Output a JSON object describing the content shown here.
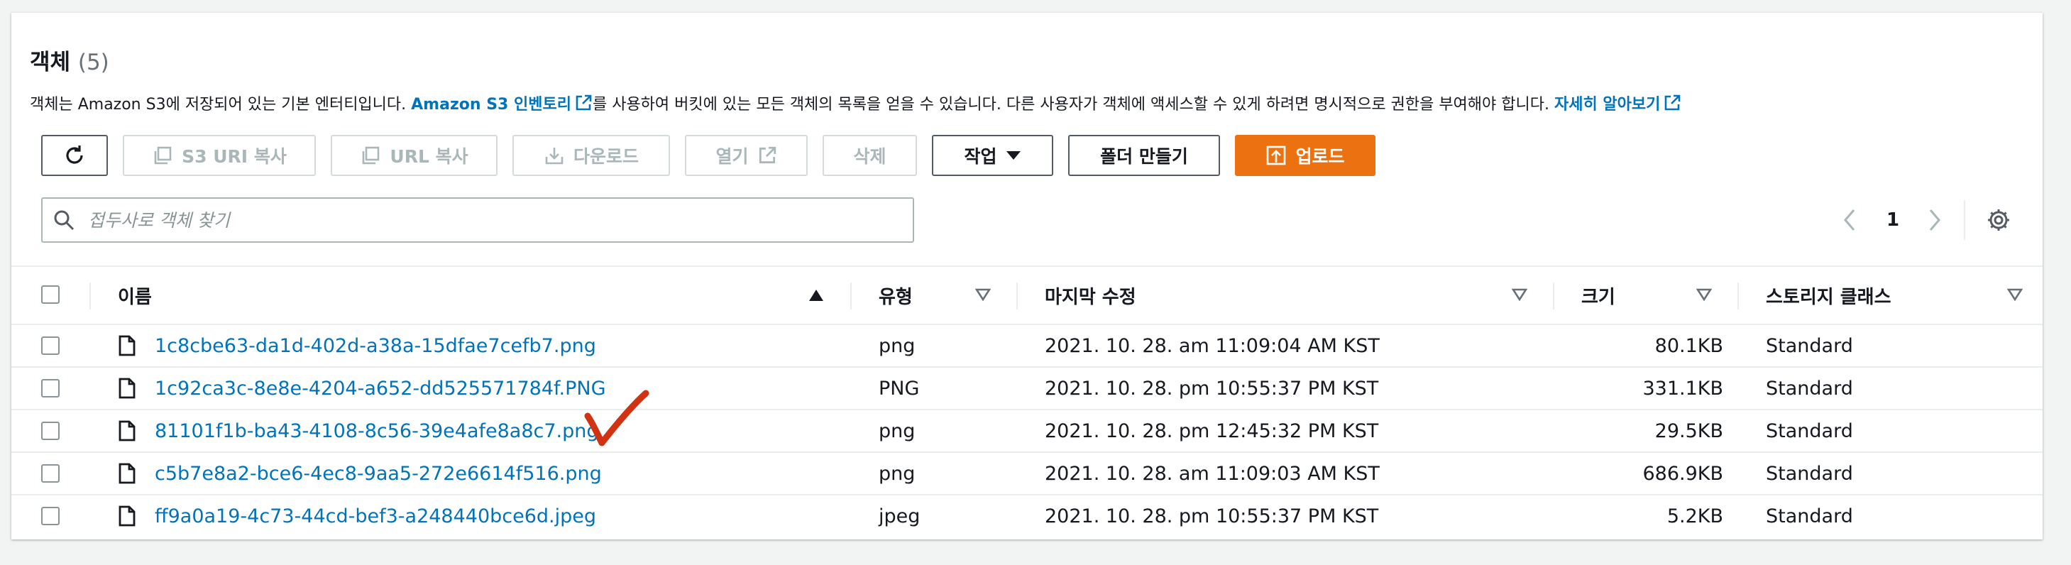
{
  "header": {
    "title": "객체",
    "count": "(5)",
    "desc_prefix": "객체는 Amazon S3에 저장되어 있는 기본 엔터티입니다. ",
    "inventory_link": "Amazon S3 인벤토리",
    "desc_middle": "를 사용하여 버킷에 있는 모든 객체의 목록을 얻을 수 있습니다. 다른 사용자가 객체에 액세스할 수 있게 하려면 명시적으로 권한을 부여해야 합니다. ",
    "learn_more_link": "자세히 알아보기"
  },
  "toolbar": {
    "refresh_icon": "refresh-icon",
    "copy_s3_uri": "S3 URI 복사",
    "copy_url": "URL 복사",
    "download": "다운로드",
    "open": "열기",
    "delete": "삭제",
    "actions": "작업",
    "create_folder": "폴더 만들기",
    "upload": "업로드"
  },
  "search": {
    "placeholder": "접두사로 객체 찾기"
  },
  "pagination": {
    "current_page": "1"
  },
  "colors": {
    "link": "#0073bb",
    "primary": "#ec7211",
    "checkmark": "#d13212"
  },
  "table": {
    "columns": {
      "name": "이름",
      "type": "유형",
      "last_modified": "마지막 수정",
      "size": "크기",
      "storage_class": "스토리지 클래스"
    },
    "rows": [
      {
        "name": "1c8cbe63-da1d-402d-a38a-15dfae7cefb7.png",
        "type": "png",
        "modified": "2021. 10. 28. am 11:09:04 AM KST",
        "size": "80.1KB",
        "storage": "Standard"
      },
      {
        "name": "1c92ca3c-8e8e-4204-a652-dd525571784f.PNG",
        "type": "PNG",
        "modified": "2021. 10. 28. pm 10:55:37 PM KST",
        "size": "331.1KB",
        "storage": "Standard"
      },
      {
        "name": "81101f1b-ba43-4108-8c56-39e4afe8a8c7.png",
        "type": "png",
        "modified": "2021. 10. 28. pm 12:45:32 PM KST",
        "size": "29.5KB",
        "storage": "Standard"
      },
      {
        "name": "c5b7e8a2-bce6-4ec8-9aa5-272e6614f516.png",
        "type": "png",
        "modified": "2021. 10. 28. am 11:09:03 AM KST",
        "size": "686.9KB",
        "storage": "Standard"
      },
      {
        "name": "ff9a0a19-4c73-44cd-bef3-a248440bce6d.jpeg",
        "type": "jpeg",
        "modified": "2021. 10. 28. pm 10:55:37 PM KST",
        "size": "5.2KB",
        "storage": "Standard"
      }
    ]
  }
}
